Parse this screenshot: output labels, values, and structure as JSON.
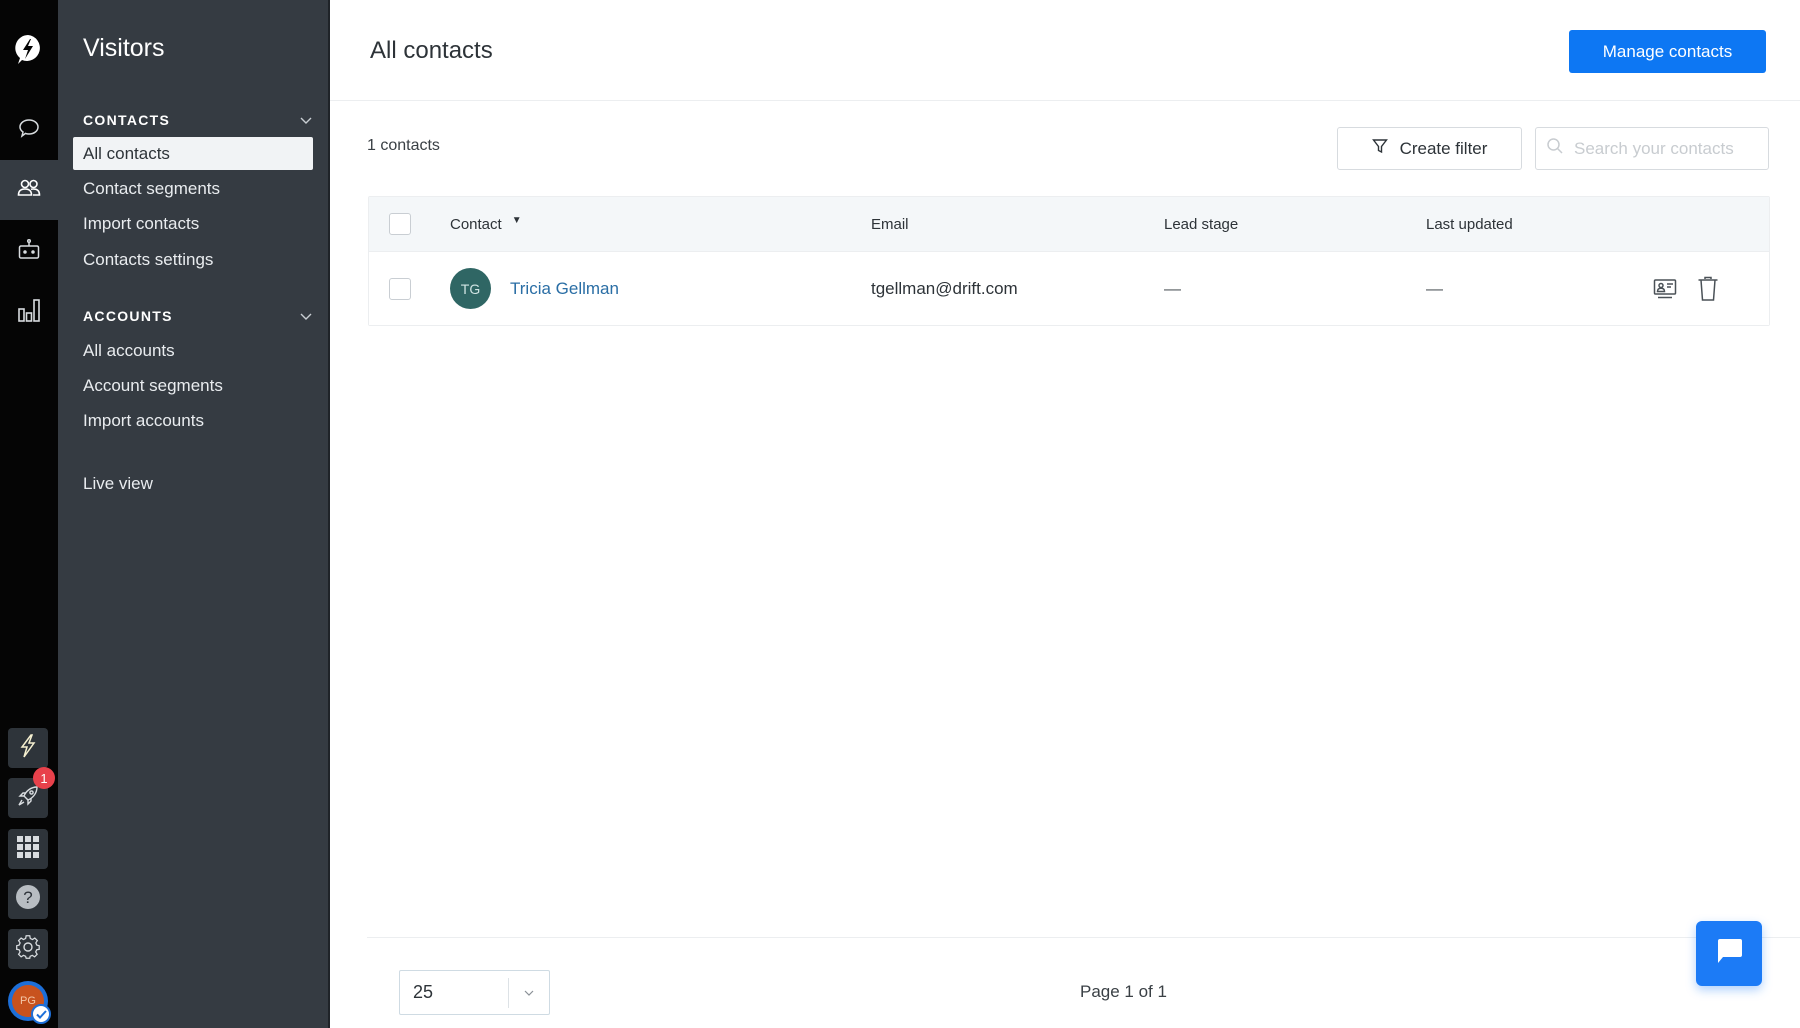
{
  "rail": {
    "logo": "drift-logo-icon",
    "items": [
      {
        "name": "conversations",
        "icon": "chat-bubble-icon",
        "active": false
      },
      {
        "name": "contacts",
        "icon": "people-icon",
        "active": true
      },
      {
        "name": "bots",
        "icon": "robot-icon",
        "active": false
      },
      {
        "name": "reports",
        "icon": "bar-chart-icon",
        "active": false
      }
    ],
    "bottom": [
      {
        "name": "playbooks",
        "icon": "lightning-icon"
      },
      {
        "name": "getting-started",
        "icon": "rocket-icon",
        "badge": "1"
      },
      {
        "name": "apps",
        "icon": "grid-icon"
      },
      {
        "name": "help",
        "icon": "help-icon"
      },
      {
        "name": "settings",
        "icon": "gear-icon"
      }
    ],
    "user_initials": "PG"
  },
  "sidebar": {
    "title": "Visitors",
    "sections": [
      {
        "heading": "CONTACTS",
        "items": [
          "All contacts",
          "Contact segments",
          "Import contacts",
          "Contacts settings"
        ],
        "selected": "All contacts"
      },
      {
        "heading": "ACCOUNTS",
        "items": [
          "All accounts",
          "Account segments",
          "Import accounts"
        ]
      }
    ],
    "extra": "Live view"
  },
  "header": {
    "title": "All contacts",
    "primary_button": "Manage contacts"
  },
  "toolbar": {
    "count": "1 contacts",
    "filter_button": "Create filter",
    "search_placeholder": "Search your contacts",
    "search_value": ""
  },
  "table": {
    "columns": [
      "Contact",
      "Email",
      "Lead stage",
      "Last updated"
    ],
    "sort_column": "Contact",
    "rows": [
      {
        "initials": "TG",
        "name": "Tricia Gellman",
        "email": "tgellman@drift.com",
        "lead_stage": "—",
        "last_updated": "—"
      }
    ]
  },
  "footer": {
    "page_size": "25",
    "page_info": "Page 1 of 1"
  },
  "colors": {
    "primary": "#0d77f3",
    "sidebar_bg": "#353b42",
    "rail_bg": "#050505",
    "avatar_bg": "#2f6664",
    "link": "#2a6ea5",
    "badge": "#e8414b"
  }
}
